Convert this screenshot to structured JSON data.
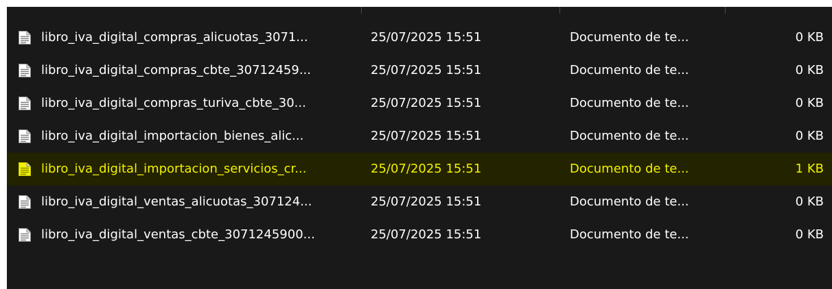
{
  "colors": {
    "background": "#191919",
    "text": "#ffffff",
    "selected_background": "#232300",
    "selected_text": "#f2f200"
  },
  "icons": {
    "file": "text-document-icon"
  },
  "files": [
    {
      "name": "libro_iva_digital_compras_alicuotas_3071...",
      "date": "25/07/2025 15:51",
      "type": "Documento de te...",
      "size": "0 KB",
      "selected": false
    },
    {
      "name": "libro_iva_digital_compras_cbte_30712459...",
      "date": "25/07/2025 15:51",
      "type": "Documento de te...",
      "size": "0 KB",
      "selected": false
    },
    {
      "name": "libro_iva_digital_compras_turiva_cbte_30...",
      "date": "25/07/2025 15:51",
      "type": "Documento de te...",
      "size": "0 KB",
      "selected": false
    },
    {
      "name": "libro_iva_digital_importacion_bienes_alic...",
      "date": "25/07/2025 15:51",
      "type": "Documento de te...",
      "size": "0 KB",
      "selected": false
    },
    {
      "name": "libro_iva_digital_importacion_servicios_cr...",
      "date": "25/07/2025 15:51",
      "type": "Documento de te...",
      "size": "1 KB",
      "selected": true
    },
    {
      "name": "libro_iva_digital_ventas_alicuotas_307124...",
      "date": "25/07/2025 15:51",
      "type": "Documento de te...",
      "size": "0 KB",
      "selected": false
    },
    {
      "name": "libro_iva_digital_ventas_cbte_3071245900...",
      "date": "25/07/2025 15:51",
      "type": "Documento de te...",
      "size": "0 KB",
      "selected": false
    }
  ]
}
